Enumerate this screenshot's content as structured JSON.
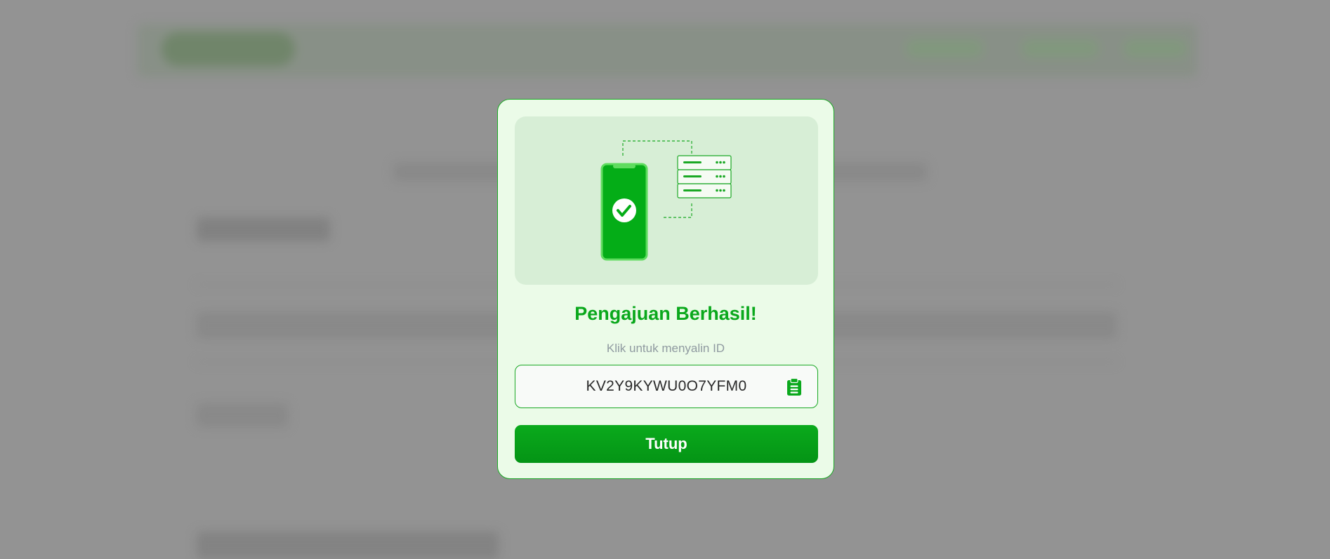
{
  "modal": {
    "title": "Pengajuan Berhasil!",
    "subtitle": "Klik untuk menyalin ID",
    "submission_id": "KV2Y9KYWU0O7YFM0",
    "copy_icon": "clipboard-icon",
    "close_label": "Tutup",
    "illustration": {
      "phone_icon": "phone-check-icon",
      "server_icon": "server-stack-icon"
    }
  },
  "colors": {
    "accent": "#0aa81c",
    "modal_bg": "#ebfbe8",
    "illustration_bg": "#d7eed6",
    "subtitle": "#8f9aa0",
    "backdrop": "#9c9c9c"
  }
}
